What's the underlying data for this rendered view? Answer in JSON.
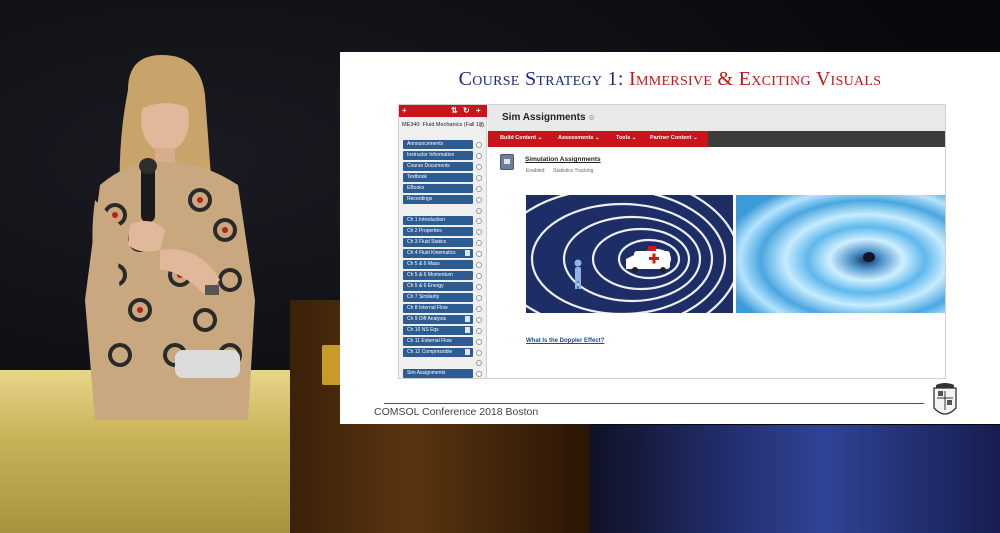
{
  "slide": {
    "title_part1": "Course Strategy 1: ",
    "title_part2": "Immersive & Exciting Visuals",
    "footer": "COMSOL Conference 2018 Boston",
    "accent_red": "#c01818",
    "accent_blue": "#1c2a7a"
  },
  "lms": {
    "top_buttons": [
      "+",
      "⇅",
      "↻",
      "+"
    ],
    "course_title": "ME340: Fluid Mechanics (Fall 18)",
    "nav_group1": [
      "Announcements",
      "Instructor Information",
      "Course Documents",
      "Textbook",
      "EBooks",
      "Recordings"
    ],
    "nav_group2": [
      "Ch 1 Introduction",
      "Ch 2 Properties",
      "Ch 3 Fluid Statics",
      "Ch 4 Fluid Kinematics",
      "Ch 5 & 6 Mass",
      "Ch 5 & 6 Momentum",
      "Ch 5 & 6 Energy",
      "Ch 7 Similarity",
      "Ch 8 Internal Flow",
      "Ch 9 Diff Analysis",
      "Ch 10 NS Eqs",
      "Ch 11 External Flow",
      "Ch 12 Compressible"
    ],
    "nav_group3": [
      "Sim Assignments"
    ],
    "page_title": "Sim Assignments",
    "menu": [
      "Build Content",
      "Assessments",
      "Tools",
      "Partner Content"
    ],
    "content_title": "Simulation Assignments",
    "content_meta": [
      "Enabled:",
      "Statistics Tracking"
    ],
    "link": "What Is the Doppler Effect?",
    "brand_red": "#c9141c",
    "nav_blue": "#2c5c92"
  }
}
